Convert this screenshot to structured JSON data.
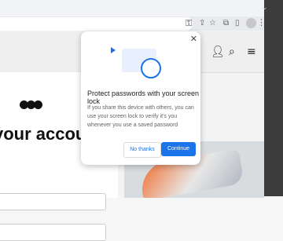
{
  "popup": {
    "title": "Protect passwords with your screen lock",
    "body": "If you share this device with others, you can use your screen lock to verify it's you whenever you use a saved password",
    "no_thanks": "No thanks",
    "continue": "Continue"
  },
  "page": {
    "heading": "your account"
  },
  "icons": {
    "key": "key-icon",
    "close": "close-icon"
  }
}
